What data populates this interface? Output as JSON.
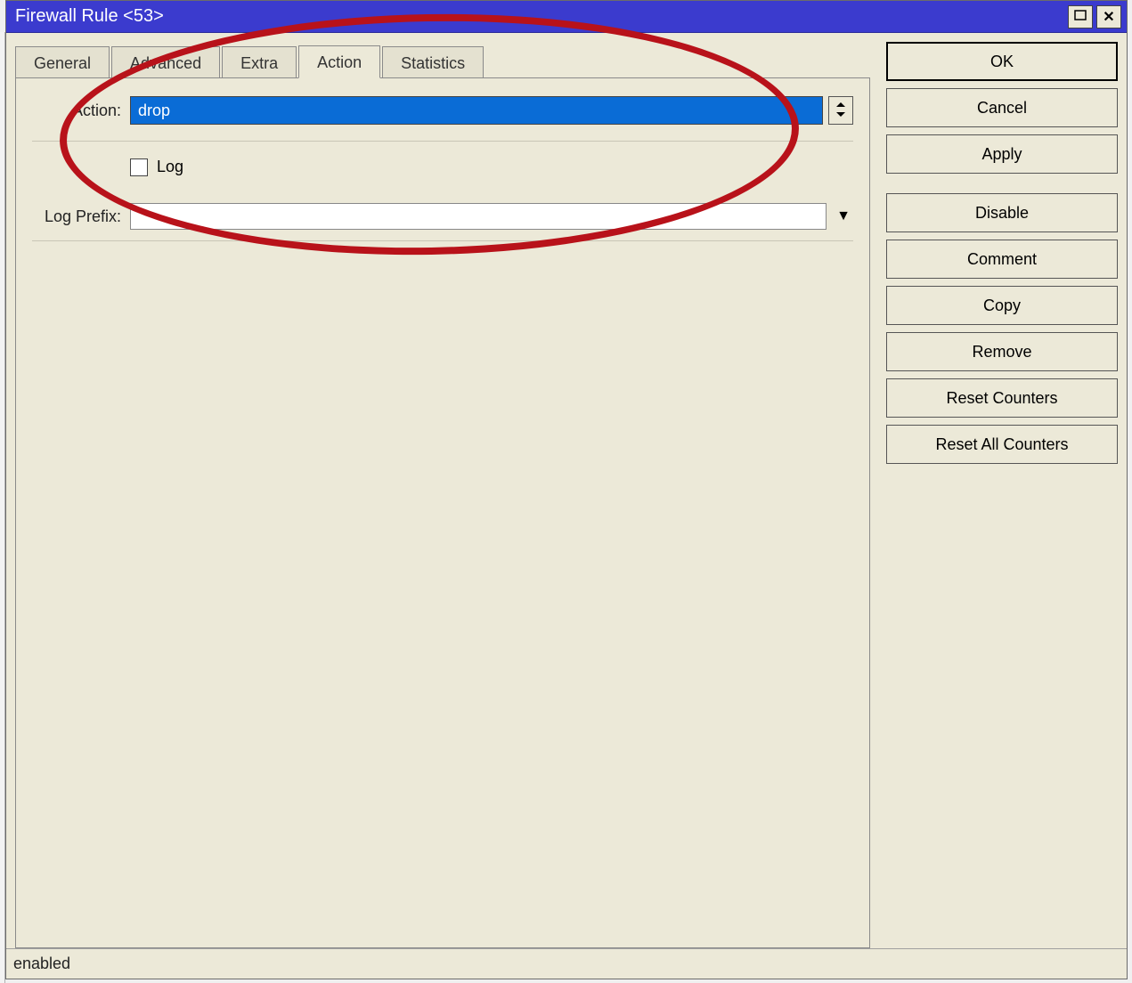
{
  "window": {
    "title": "Firewall Rule <53>"
  },
  "tabs": {
    "general": "General",
    "advanced": "Advanced",
    "extra": "Extra",
    "action": "Action",
    "statistics": "Statistics"
  },
  "form": {
    "action_label": "Action:",
    "action_value": "drop",
    "log_label": "Log",
    "log_prefix_label": "Log Prefix:",
    "log_prefix_value": ""
  },
  "buttons": {
    "ok": "OK",
    "cancel": "Cancel",
    "apply": "Apply",
    "disable": "Disable",
    "comment": "Comment",
    "copy": "Copy",
    "remove": "Remove",
    "reset_counters": "Reset Counters",
    "reset_all_counters": "Reset All Counters"
  },
  "status": {
    "text": "enabled"
  }
}
